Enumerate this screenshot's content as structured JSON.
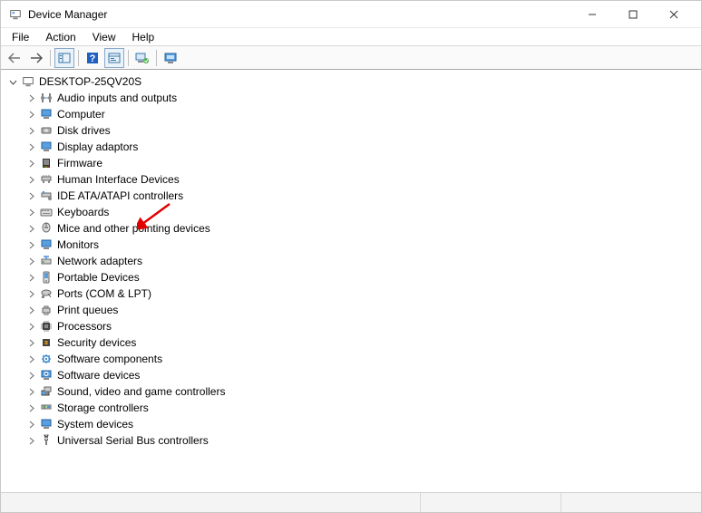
{
  "window": {
    "title": "Device Manager"
  },
  "menu": {
    "file": "File",
    "action": "Action",
    "view": "View",
    "help": "Help"
  },
  "tree": {
    "root": "DESKTOP-25QV20S",
    "items": [
      "Audio inputs and outputs",
      "Computer",
      "Disk drives",
      "Display adaptors",
      "Firmware",
      "Human Interface Devices",
      "IDE ATA/ATAPI controllers",
      "Keyboards",
      "Mice and other pointing devices",
      "Monitors",
      "Network adapters",
      "Portable Devices",
      "Ports (COM & LPT)",
      "Print queues",
      "Processors",
      "Security devices",
      "Software components",
      "Software devices",
      "Sound, video and game controllers",
      "Storage controllers",
      "System devices",
      "Universal Serial Bus controllers"
    ]
  },
  "annotation": {
    "target_index": 3
  }
}
